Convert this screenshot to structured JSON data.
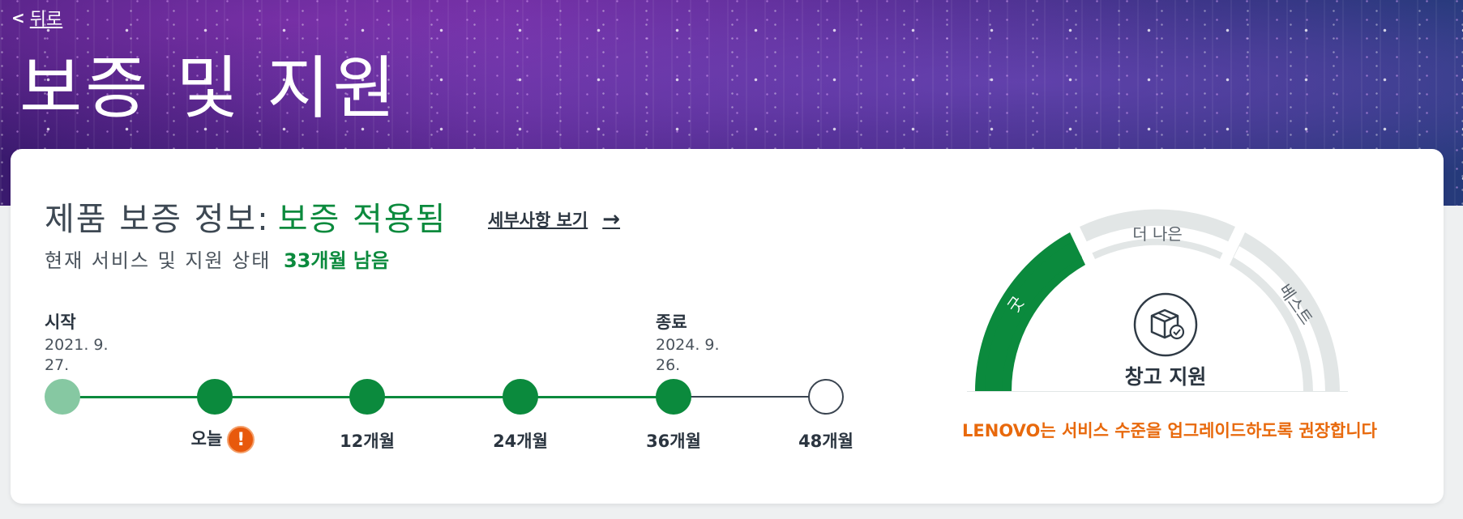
{
  "nav": {
    "back_arrow": "<",
    "back_label": "뒤로"
  },
  "page_title": "보증 및 지원",
  "card": {
    "heading_label": "제품 보증 정보:",
    "heading_status": "보증 적용됨",
    "details_link": "세부사항 보기",
    "remaining_prefix": "현재 서비스 및 지원 상태",
    "remaining_value": "33개월 남음"
  },
  "timeline": {
    "start_label": "시작",
    "start_date_line1": "2021. 9.",
    "start_date_line2": "27.",
    "end_label": "종료",
    "end_date_line1": "2024. 9.",
    "end_date_line2": "26.",
    "ticks": [
      "오늘",
      "12개월",
      "24개월",
      "36개월",
      "48개월"
    ],
    "alert_symbol": "!"
  },
  "gauge": {
    "levels": [
      "굿",
      "더 나은",
      "베스트"
    ],
    "current_level": "굿",
    "center_label": "창고 지원",
    "center_icon": "warehouse-box-check-icon"
  },
  "recommendation": "LENOVO는 서비스 수준을 업그레이드하도록 권장합니다",
  "colors": {
    "green": "#0b8a3d",
    "light_green": "#86c8a2",
    "orange": "#e8690c",
    "gauge_track": "#e2e6e6"
  }
}
